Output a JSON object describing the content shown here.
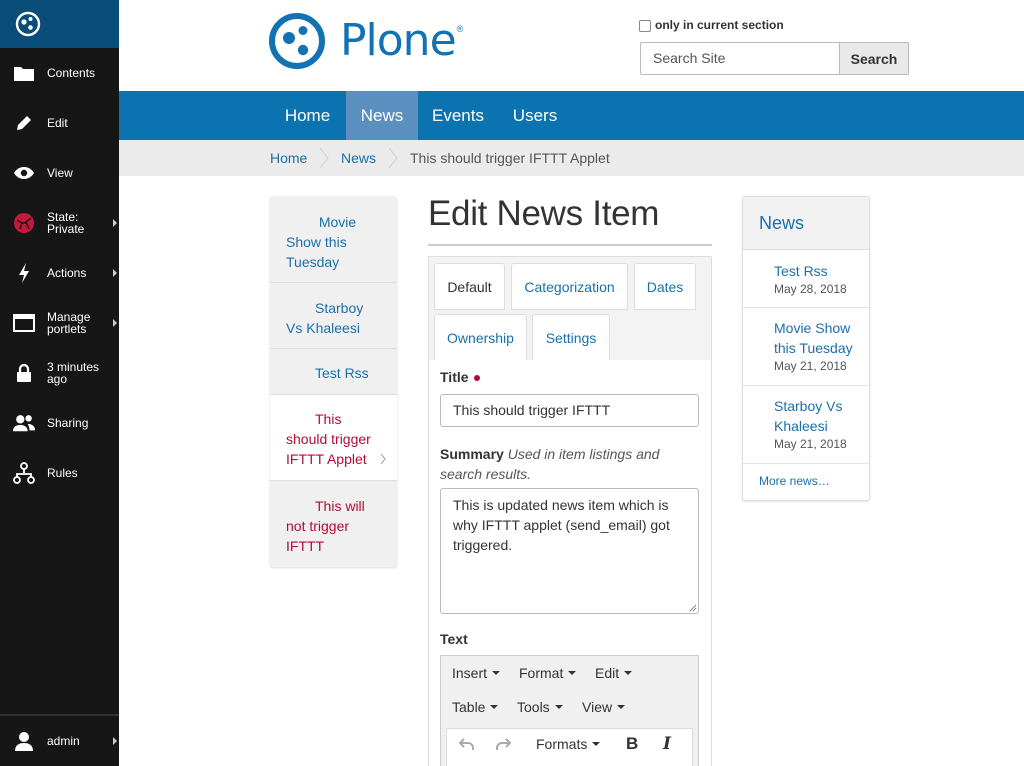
{
  "toolbar": {
    "items": [
      {
        "label": "Contents",
        "icon": "folder-icon"
      },
      {
        "label": "Edit",
        "icon": "pencil-icon"
      },
      {
        "label": "View",
        "icon": "eye-icon"
      },
      {
        "label": "State: Private",
        "icon": "state-icon",
        "color": "#c4183c"
      },
      {
        "label": "Actions",
        "icon": "bolt-icon"
      },
      {
        "label": "Manage portlets",
        "icon": "portlets-icon"
      },
      {
        "label": "3 minutes ago",
        "icon": "lock-icon"
      },
      {
        "label": "Sharing",
        "icon": "users-icon"
      },
      {
        "label": "Rules",
        "icon": "rules-icon"
      }
    ],
    "user": "admin"
  },
  "header": {
    "logo_text": "Plone",
    "logo_mark": "®",
    "search": {
      "only_current_section": "only in current section",
      "placeholder": "Search Site",
      "button": "Search"
    }
  },
  "nav": {
    "items": [
      "Home",
      "News",
      "Events",
      "Users"
    ],
    "active": "News"
  },
  "breadcrumbs": {
    "items": [
      "Home",
      "News"
    ],
    "current": "This should trigger IFTTT Applet"
  },
  "left_portlet": {
    "items": [
      {
        "lines": [
          "Movie",
          "Show this",
          "Tuesday"
        ]
      },
      {
        "lines": [
          "Starboy",
          "Vs Khaleesi"
        ]
      },
      {
        "lines": [
          "Test Rss"
        ]
      },
      {
        "lines": [
          "This",
          "should trigger",
          "IFTTT Applet"
        ]
      },
      {
        "lines": [
          "This will",
          "not trigger",
          "IFTTT"
        ]
      }
    ]
  },
  "main": {
    "title": "Edit News Item",
    "tabs": [
      "Default",
      "Categorization",
      "Dates",
      "Ownership",
      "Settings"
    ],
    "fields": {
      "title_label": "Title",
      "title_value": "This should trigger IFTTT",
      "summary_label": "Summary",
      "summary_help_1": "Used in item listings and",
      "summary_help_2": "search results.",
      "summary_lines": [
        "This is updated news item which is",
        "why IFTTT applet (send_email) got",
        "triggered."
      ],
      "text_label": "Text"
    },
    "editor": {
      "menus_row1": [
        "Insert",
        "Format",
        "Edit"
      ],
      "menus_row2": [
        "Table",
        "Tools",
        "View"
      ],
      "formats": "Formats",
      "bold": "B",
      "italic": "I"
    }
  },
  "right_portlet": {
    "title": "News",
    "items": [
      {
        "lines": [
          "Test Rss"
        ],
        "date": "May 28, 2018"
      },
      {
        "lines": [
          "Movie Show",
          "this Tuesday"
        ],
        "date": "May 21, 2018"
      },
      {
        "lines": [
          "Starboy Vs",
          "Khaleesi"
        ],
        "date": "May 21, 2018"
      }
    ],
    "more": "More news…"
  }
}
